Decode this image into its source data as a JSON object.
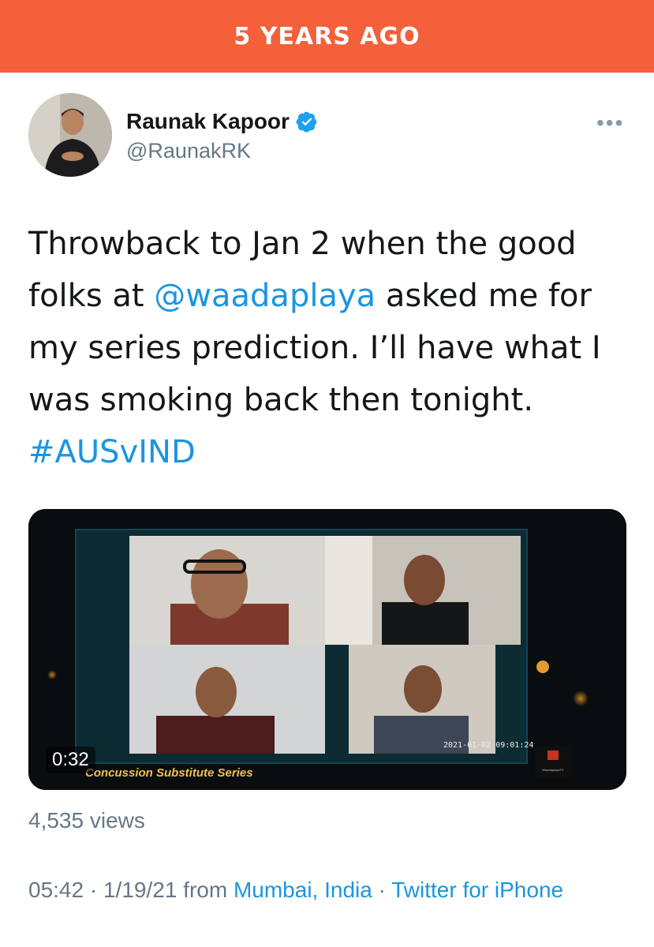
{
  "banner": {
    "text": "5 YEARS AGO"
  },
  "author": {
    "name": "Raunak Kapoor",
    "handle": "@RaunakRK",
    "verified_icon": "verified-badge-icon",
    "avatar_icon": "profile-photo"
  },
  "menu": {
    "icon": "more-options-icon",
    "glyph": "•••"
  },
  "tweet": {
    "line1": "Throwback to Jan 2 when the good",
    "line2_pre": "folks at ",
    "mention": "@waadaplaya",
    "line2_post": " asked me for",
    "line3": "my series prediction. I’ll have what I",
    "line4": "was smoking back then tonight.",
    "hashtag": "#AUSvIND"
  },
  "video": {
    "duration": "0:32",
    "caption": "Concussion Substitute Series",
    "timestamp": "2021-01-02 09:01:24",
    "logo_text": "WaadaplayaTV"
  },
  "stats": {
    "views": "4,535 views"
  },
  "meta": {
    "time": "05:42",
    "sep1": " · ",
    "date": "1/19/21",
    "from": " from ",
    "location": "Mumbai, India",
    "sep2": " · ",
    "source": "Twitter for iPhone"
  },
  "colors": {
    "banner": "#f4603a",
    "link": "#1b95e0",
    "muted": "#657786",
    "text": "#14171a"
  }
}
